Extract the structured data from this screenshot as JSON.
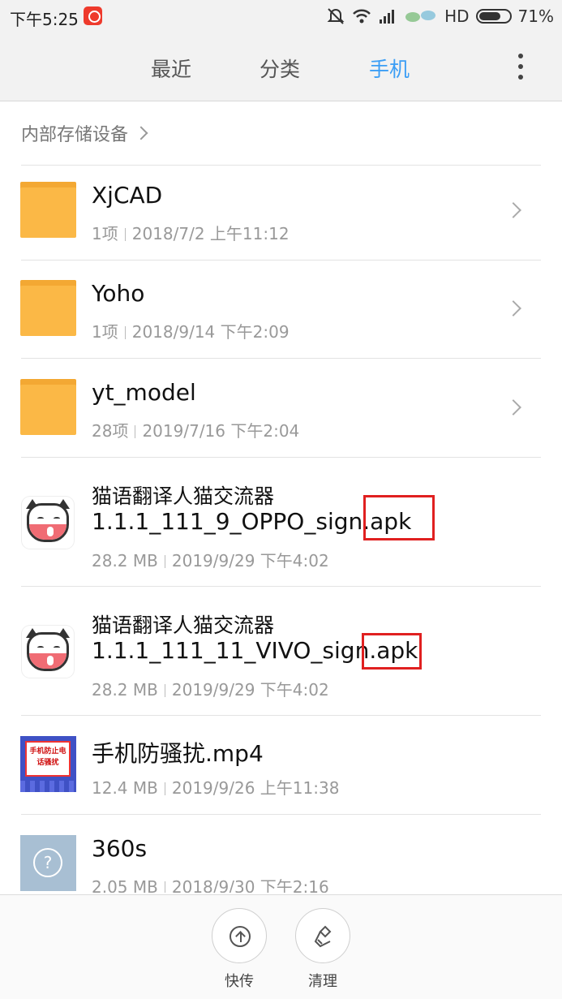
{
  "status_bar": {
    "time": "下午5:25",
    "network": "HD",
    "battery": "71%",
    "battery_level": 0.71,
    "icons": [
      "app-notification-icon",
      "mute-icon",
      "wifi-icon",
      "signal-icon",
      "leaf-icon",
      "battery-icon"
    ]
  },
  "tabs": [
    {
      "label": "最近",
      "active": false
    },
    {
      "label": "分类",
      "active": false
    },
    {
      "label": "手机",
      "active": true
    }
  ],
  "accent_color": "#3c9ef5",
  "breadcrumb": "内部存储设备",
  "files": [
    {
      "type": "folder",
      "name": "XjCAD",
      "count": "1项",
      "date": "2018/7/2 上午11:12"
    },
    {
      "type": "folder",
      "name": "Yoho",
      "count": "1项",
      "date": "2018/9/14 下午2:09"
    },
    {
      "type": "folder",
      "name": "yt_model",
      "count": "28项",
      "date": "2019/7/16 下午2:04"
    },
    {
      "type": "apk",
      "name_line1": "猫语翻译人猫交流器",
      "name_line2_base": "1.1.1_111_9_OPPO_sign",
      "ext": ".apk",
      "size": "28.2 MB",
      "date": "2019/9/29 下午4:02"
    },
    {
      "type": "apk",
      "name_line1": "猫语翻译人猫交流器",
      "name_line2_base": "1.1.1_111_11_VIVO_sign",
      "ext": ".apk",
      "size": "28.2 MB",
      "date": "2019/9/29 下午4:02"
    },
    {
      "type": "video",
      "name": "手机防骚扰.mp4",
      "thumb_text": "手机防止电话骚扰",
      "size": "12.4 MB",
      "date": "2019/9/26 上午11:38"
    },
    {
      "type": "unknown",
      "name": "360s",
      "size": "2.05 MB",
      "date": "2018/9/30 下午2:16"
    }
  ],
  "highlight_color": "#e02020",
  "bottom_bar": {
    "share_label": "快传",
    "clean_label": "清理"
  }
}
